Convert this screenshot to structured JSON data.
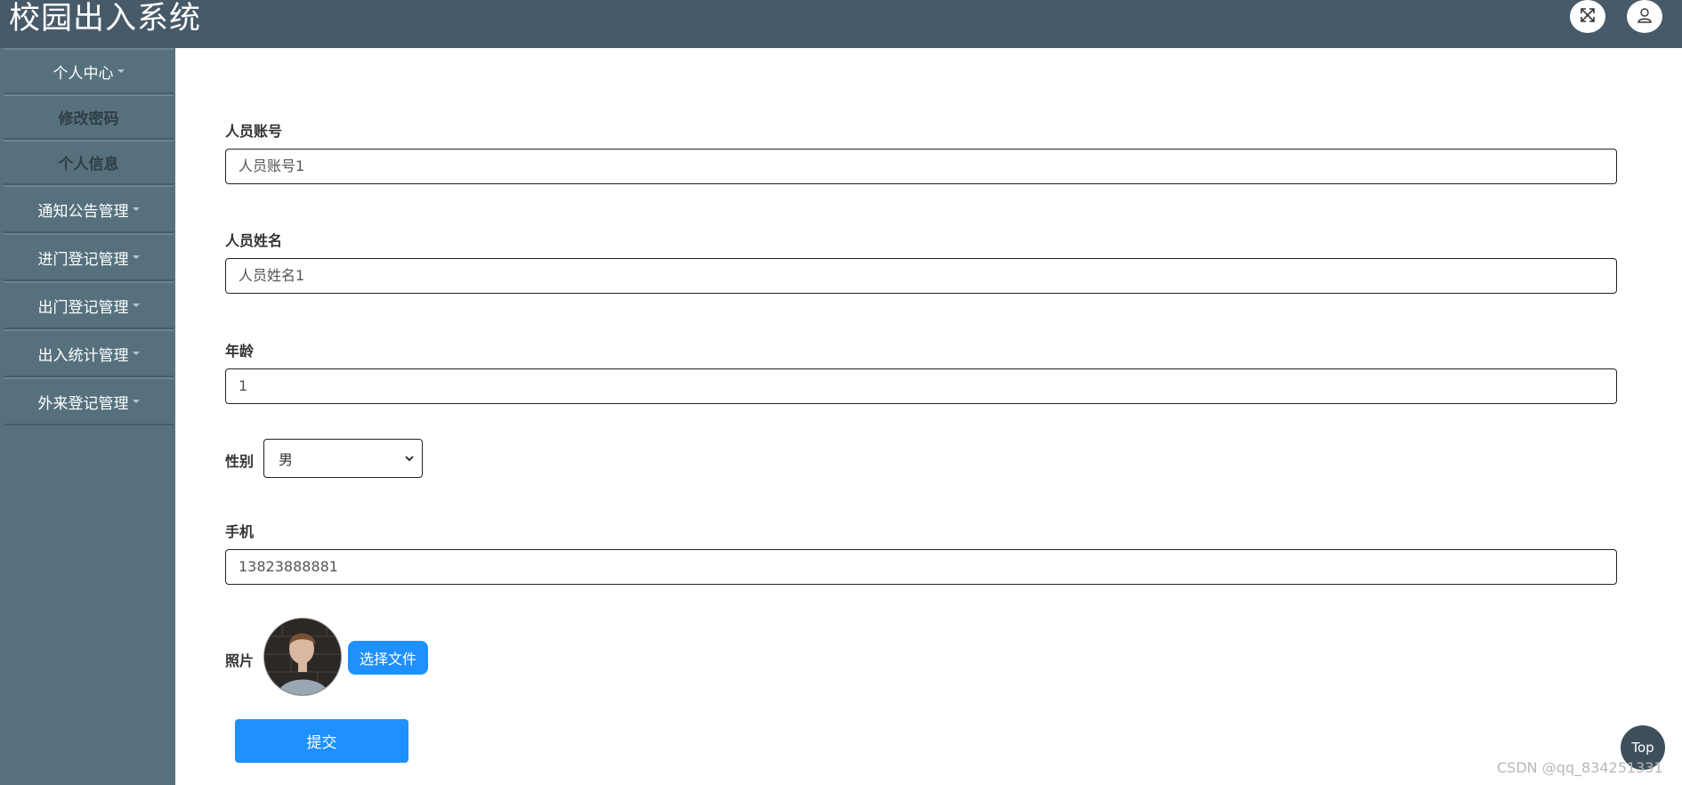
{
  "app": {
    "title": "校园出入系统"
  },
  "header": {
    "fullscreen_icon": "fullscreen-icon",
    "user_icon": "user-icon"
  },
  "sidebar": {
    "items": [
      {
        "label": "个人中心",
        "has_caret": true
      },
      {
        "label": "修改密码",
        "has_caret": false
      },
      {
        "label": "个人信息",
        "has_caret": false
      },
      {
        "label": "通知公告管理",
        "has_caret": true
      },
      {
        "label": "进门登记管理",
        "has_caret": true
      },
      {
        "label": "出门登记管理",
        "has_caret": true
      },
      {
        "label": "出入统计管理",
        "has_caret": true
      },
      {
        "label": "外来登记管理",
        "has_caret": true
      }
    ]
  },
  "form": {
    "account": {
      "label": "人员账号",
      "value": "人员账号1"
    },
    "name": {
      "label": "人员姓名",
      "value": "人员姓名1"
    },
    "age": {
      "label": "年龄",
      "value": "1"
    },
    "gender": {
      "label": "性别",
      "value": "男"
    },
    "phone": {
      "label": "手机",
      "value": "13823888881"
    },
    "photo": {
      "label": "照片",
      "choose_file_label": "选择文件"
    },
    "submit_label": "提交"
  },
  "back_to_top_label": "Top",
  "watermark": "CSDN @qq_834251331",
  "colors": {
    "topbar": "#475a69",
    "sidebar": "#56717d",
    "primary_button": "#1e90ff",
    "top_button": "#3e4f5c"
  }
}
